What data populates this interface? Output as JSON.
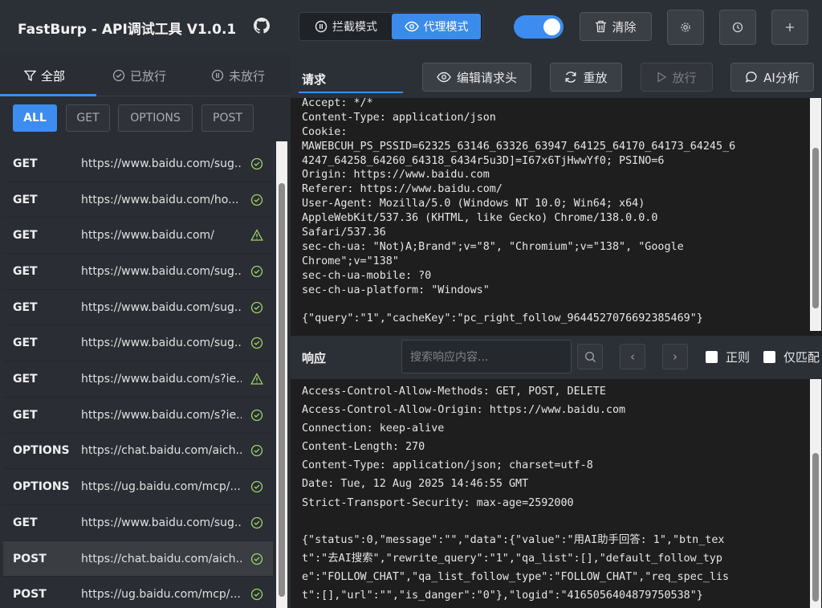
{
  "header": {
    "title": "FastBurp - API调试工具 V1.0.1",
    "intercept_label": "拦截模式",
    "proxy_label": "代理模式",
    "clear_label": "清除"
  },
  "filters": {
    "tabs": [
      {
        "label": "全部"
      },
      {
        "label": "已放行"
      },
      {
        "label": "未放行"
      }
    ],
    "methods": [
      "ALL",
      "GET",
      "OPTIONS",
      "POST"
    ]
  },
  "requests": [
    {
      "method": "GET",
      "url": "https://www.baidu.com/sug...",
      "status": "ok"
    },
    {
      "method": "GET",
      "url": "https://www.baidu.com/ho...",
      "status": "ok"
    },
    {
      "method": "GET",
      "url": "https://www.baidu.com/",
      "status": "warn"
    },
    {
      "method": "GET",
      "url": "https://www.baidu.com/sug...",
      "status": "ok"
    },
    {
      "method": "GET",
      "url": "https://www.baidu.com/sug...",
      "status": "ok"
    },
    {
      "method": "GET",
      "url": "https://www.baidu.com/sug...",
      "status": "ok"
    },
    {
      "method": "GET",
      "url": "https://www.baidu.com/s?ie...",
      "status": "warn"
    },
    {
      "method": "GET",
      "url": "https://www.baidu.com/s?ie...",
      "status": "ok"
    },
    {
      "method": "OPTIONS",
      "url": "https://chat.baidu.com/aich...",
      "status": "ok"
    },
    {
      "method": "OPTIONS",
      "url": "https://ug.baidu.com/mcp/...",
      "status": "ok"
    },
    {
      "method": "GET",
      "url": "https://www.baidu.com/sug...",
      "status": "ok"
    },
    {
      "method": "POST",
      "url": "https://chat.baidu.com/aich...",
      "status": "ok",
      "selected": true
    },
    {
      "method": "POST",
      "url": "https://ug.baidu.com/mcp/...",
      "status": "ok"
    }
  ],
  "request": {
    "label": "请求",
    "edit_headers_label": "编辑请求头",
    "replay_label": "重放",
    "release_label": "放行",
    "ai_label": "AI分析",
    "lines": [
      "Accept: */*",
      "Content-Type: application/json",
      "Cookie:",
      "MAWEBCUH_PS_PSSID=62325_63146_63326_63947_64125_64170_64173_64245_6",
      "4247_64258_64260_64318_6434r5u3D]=I67x6TjHwwYf0; PSINO=6",
      "Origin: https://www.baidu.com",
      "Referer: https://www.baidu.com/",
      "User-Agent: Mozilla/5.0 (Windows NT 10.0; Win64; x64)",
      "AppleWebKit/537.36 (KHTML, like Gecko) Chrome/138.0.0.0",
      "Safari/537.36",
      "sec-ch-ua: \"Not)A;Brand\";v=\"8\", \"Chromium\";v=\"138\", \"Google",
      "Chrome\";v=\"138\"",
      "sec-ch-ua-mobile: ?0",
      "sec-ch-ua-platform: \"Windows\"",
      "",
      "{\"query\":\"1\",\"cacheKey\":\"pc_right_follow_9644527076692385469\"}"
    ]
  },
  "response": {
    "label": "响应",
    "search_placeholder": "搜索响应内容...",
    "regex_label": "正则",
    "whole_match_label": "仅匹配",
    "lines": [
      "Access-Control-Allow-Methods: GET, POST, DELETE",
      "Access-Control-Allow-Origin: https://www.baidu.com",
      "Connection: keep-alive",
      "Content-Length: 270",
      "Content-Type: application/json; charset=utf-8",
      "Date: Tue, 12 Aug 2025 14:46:55 GMT",
      "Strict-Transport-Security: max-age=2592000",
      "",
      "{\"status\":0,\"message\":\"\",\"data\":{\"value\":\"用AI助手回答: 1\",\"btn_tex",
      "t\":\"去AI搜索\",\"rewrite_query\":\"1\",\"qa_list\":[],\"default_follow_typ",
      "e\":\"FOLLOW_CHAT\",\"qa_list_follow_type\":\"FOLLOW_CHAT\",\"req_spec_lis",
      "t\":[],\"url\":\"\",\"is_danger\":\"0\"},\"logid\":\"4165056404879750538\"}"
    ]
  }
}
